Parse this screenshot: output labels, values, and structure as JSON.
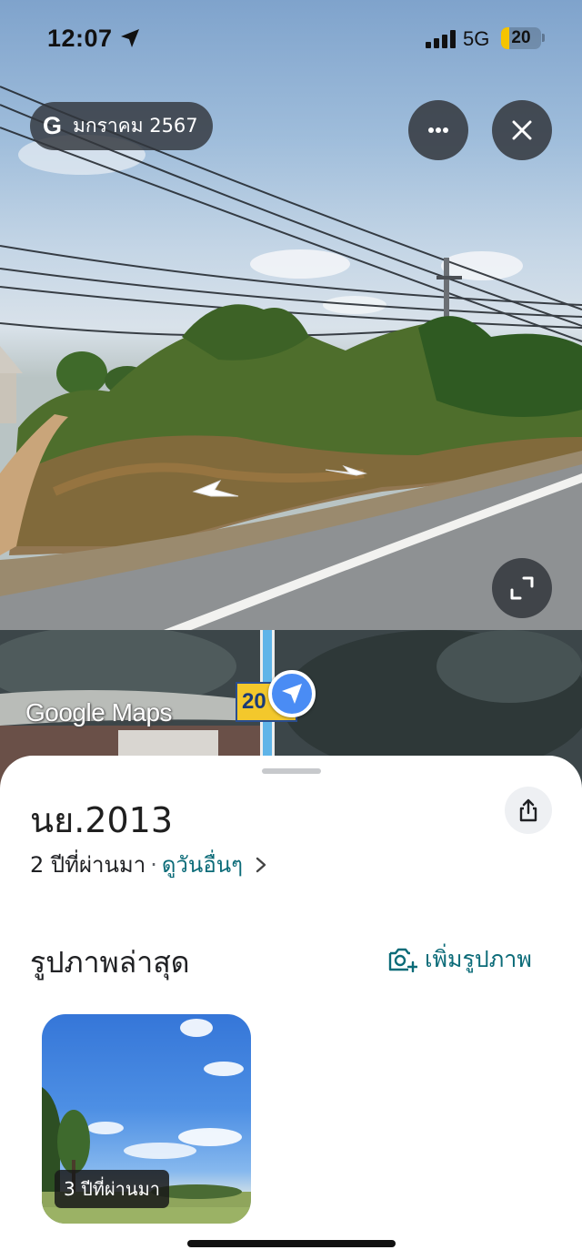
{
  "status_bar": {
    "time": "12:07",
    "network": "5G",
    "battery": "20",
    "battery_level_percent": 20,
    "signal_bars": 4
  },
  "street_view": {
    "provider_logo": "G",
    "capture_month": "มกราคม 2567",
    "icons": [
      "location-arrow-icon",
      "more-icon",
      "close-icon",
      "fullscreen-icon",
      "nav-arrow-icon"
    ]
  },
  "mini_map": {
    "watermark": "Google Maps",
    "road_number": "20"
  },
  "sheet": {
    "capture_date": "นย.2013",
    "age": "2 ปีที่ผ่านมา",
    "separator": "·",
    "see_other_dates": "ดูวันอื่นๆ",
    "latest_photos_title": "รูปภาพล่าสุด",
    "add_photo": "เพิ่มรูปภาพ",
    "photos": [
      {
        "age_label": "3 ปีที่ผ่านมา"
      }
    ]
  },
  "colors": {
    "accent": "#0b6b78",
    "pin": "#4a8cf4",
    "road_badge": "#f3c82c"
  }
}
